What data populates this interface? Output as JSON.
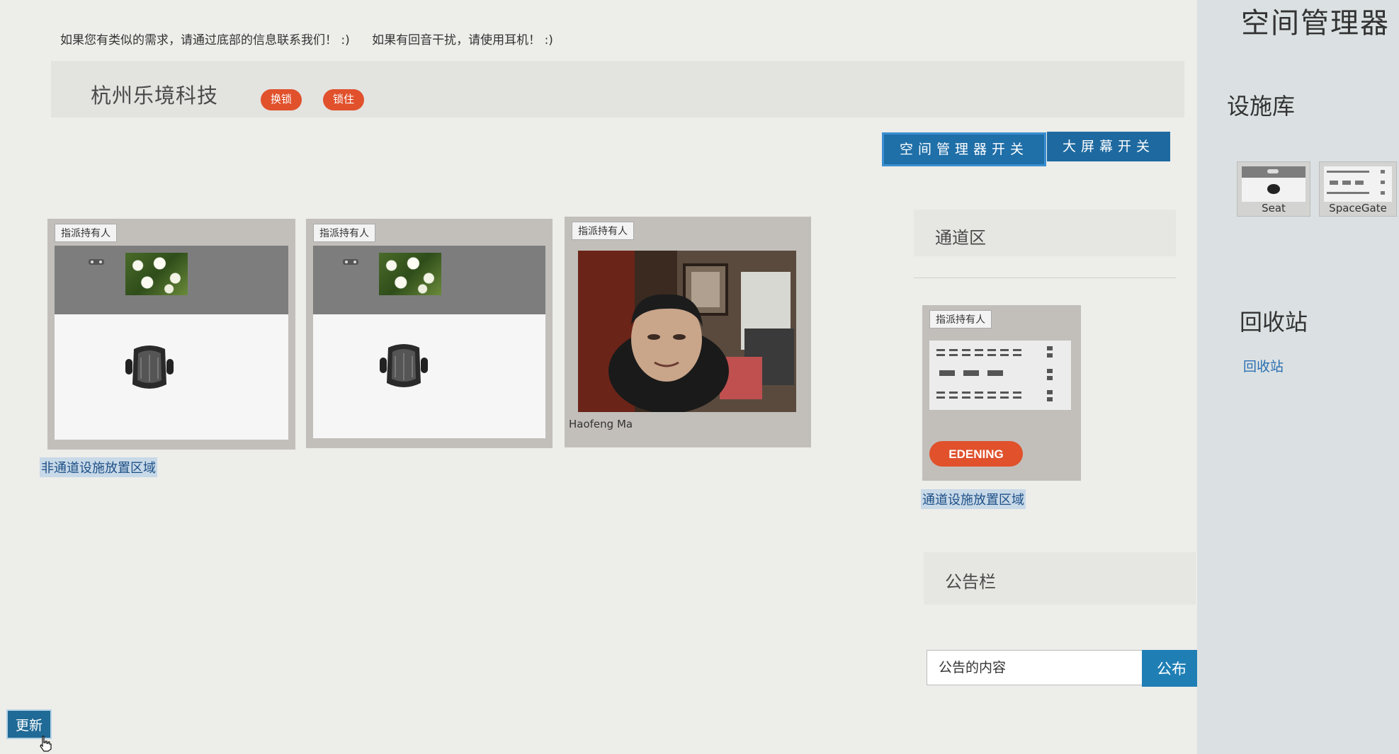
{
  "notice": {
    "contact": "如果您有类似的需求，请通过底部的信息联系我们！ :)",
    "headphones": "如果有回音干扰，请使用耳机！ :)"
  },
  "header": {
    "company": "杭州乐境科技",
    "swap_label": "换锁",
    "lock_label": "锁住"
  },
  "toggles": {
    "space_manager": "空间管理器开关",
    "big_screen": "大屏幕开关"
  },
  "non_aisle": {
    "cards": [
      {
        "tag": "指派持有人"
      },
      {
        "tag": "指派持有人"
      },
      {
        "tag": "指派持有人",
        "name": "Haofeng Ma"
      }
    ],
    "link": "非通道设施放置区域"
  },
  "aisle": {
    "title": "通道区",
    "card_tag": "指派持有人",
    "gate_button": "EDENING",
    "link": "通道设施放置区域"
  },
  "announcement": {
    "title": "公告栏",
    "placeholder": "公告的内容",
    "publish": "公布"
  },
  "update_button": "更新",
  "panel": {
    "title": "空间管理器",
    "library_title": "设施库",
    "library_items": [
      {
        "label": "Seat",
        "icon": "seat-icon"
      },
      {
        "label": "SpaceGate",
        "icon": "space-gate-icon"
      }
    ],
    "recycle_title": "回收站",
    "recycle_link": "回收站"
  },
  "colors": {
    "accent_red": "#e0512c",
    "primary_blue": "#1f6fa8",
    "link_blue": "#1d4f86"
  }
}
